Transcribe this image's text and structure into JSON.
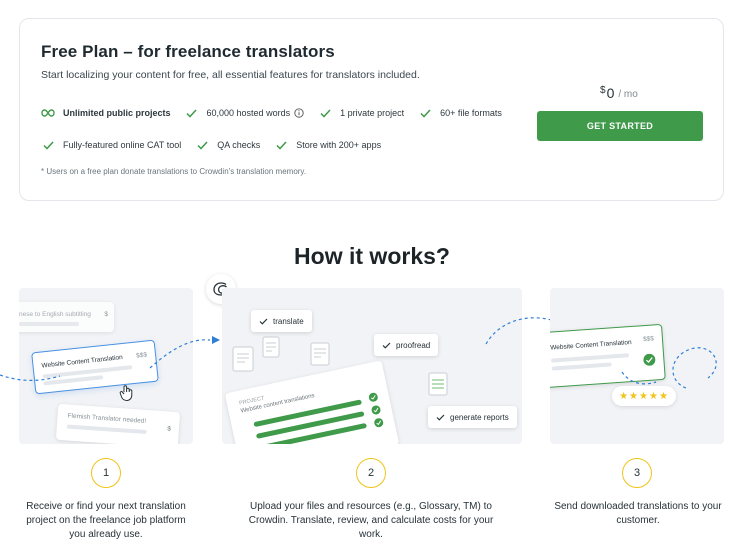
{
  "plan": {
    "title": "Free Plan – for freelance translators",
    "subtitle": "Start localizing your content for free, all essential features for translators included.",
    "features_row1": [
      {
        "label": "Unlimited public projects",
        "icon": "infinity-icon"
      },
      {
        "label": "60,000 hosted words",
        "icon": "check-icon",
        "info": true
      },
      {
        "label": "1 private project",
        "icon": "check-icon"
      },
      {
        "label": "60+ file formats",
        "icon": "check-icon"
      }
    ],
    "features_row2": [
      {
        "label": "Fully-featured online CAT tool",
        "icon": "check-icon"
      },
      {
        "label": "QA checks",
        "icon": "check-icon"
      },
      {
        "label": "Store with 200+ apps",
        "icon": "check-icon"
      }
    ],
    "footnote": "* Users on a free plan donate translations to Crowdin's translation memory.",
    "price": {
      "currency": "$",
      "amount": "0",
      "period": "/ mo"
    },
    "cta_label": "GET STARTED"
  },
  "how": {
    "title": "How it works?",
    "panel1": {
      "card_top": "nese to English subtitling",
      "card_top_price": "$",
      "card_main": "Website Content Translation",
      "card_main_price": "$$$",
      "card_bottom": "Flemish Translator needed!",
      "card_bottom_price": "$"
    },
    "panel2": {
      "tag_translate": "translate",
      "tag_proofread": "proofread",
      "tag_reports": "generate reports",
      "project_label": "PROJECT",
      "project_name": "Website content translations"
    },
    "panel3": {
      "card_title": "Website Content Translation",
      "card_price": "$$$",
      "stars": "★★★★★"
    },
    "steps": [
      {
        "num": "1",
        "text": "Receive or find your next translation project on the freelance job platform you already use."
      },
      {
        "num": "2",
        "text": "Upload your files and resources (e.g., Glossary, TM) to Crowdin. Translate, review, and calculate costs for your work."
      },
      {
        "num": "3",
        "text": "Send downloaded translations to your customer."
      }
    ]
  },
  "colors": {
    "accent_green": "#3f9a4a",
    "step_ring": "#f0c419",
    "flow_blue": "#2f7fd6"
  }
}
